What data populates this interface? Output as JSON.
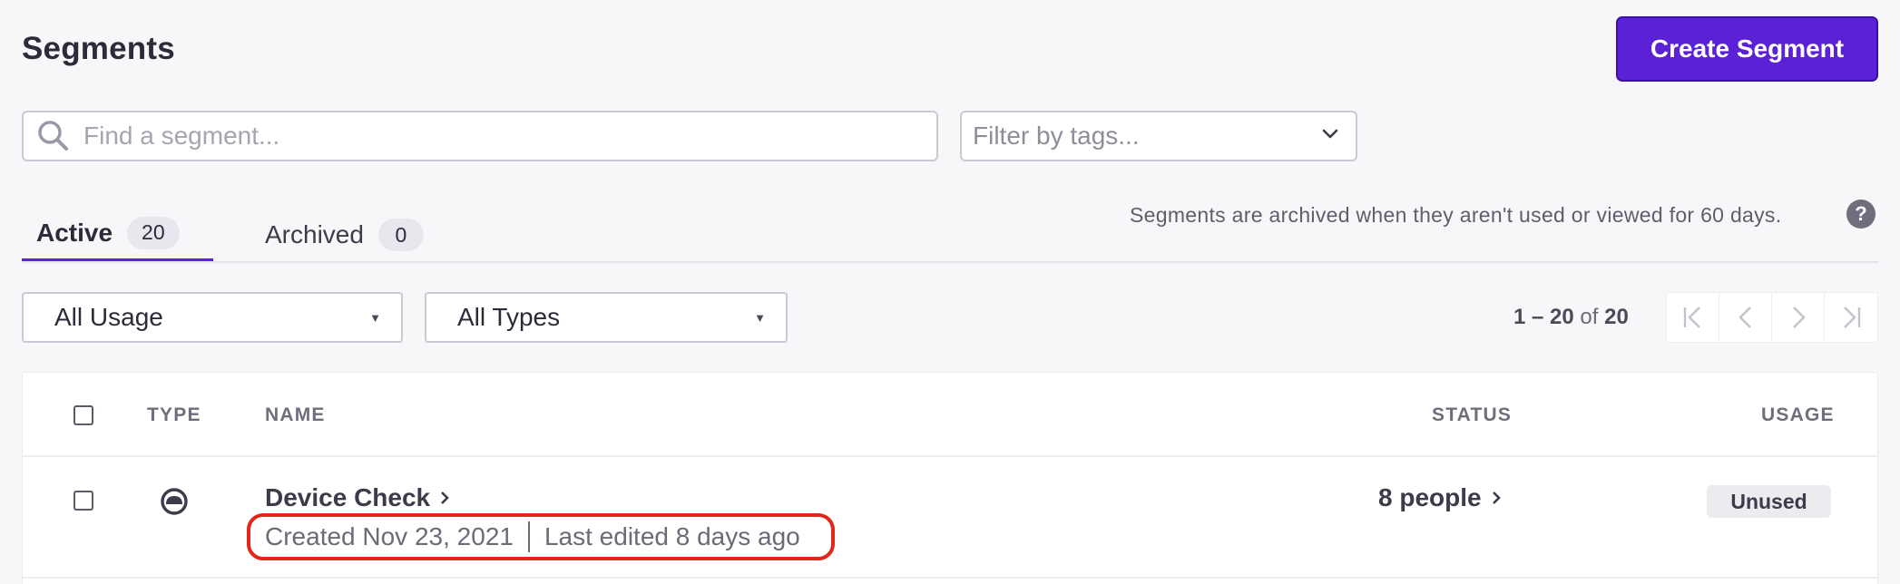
{
  "header": {
    "title": "Segments",
    "create_button": "Create Segment"
  },
  "search": {
    "placeholder": "Find a segment..."
  },
  "tag_filter": {
    "placeholder": "Filter by tags..."
  },
  "tabs": [
    {
      "label": "Active",
      "count": "20"
    },
    {
      "label": "Archived",
      "count": "0"
    }
  ],
  "archive_note": "Segments are archived when they aren't used or viewed for 60 days.",
  "filters": {
    "usage": "All Usage",
    "types": "All Types"
  },
  "pagination": {
    "range": "1 – 20",
    "of": "of",
    "total": "20"
  },
  "table": {
    "columns": {
      "type": "TYPE",
      "name": "NAME",
      "status": "STATUS",
      "usage": "USAGE"
    },
    "rows": [
      {
        "name": "Device Check",
        "created": "Created Nov 23, 2021",
        "edited": "Last edited 8 days ago",
        "status": "8 people",
        "usage": "Unused"
      }
    ]
  },
  "colors": {
    "accent": "#5b21d6",
    "highlight": "#e3251c"
  },
  "icons": [
    "search-icon",
    "chevron-down-icon",
    "help-icon",
    "first-page-icon",
    "prev-page-icon",
    "next-page-icon",
    "last-page-icon",
    "segment-type-icon",
    "chevron-right-icon"
  ]
}
